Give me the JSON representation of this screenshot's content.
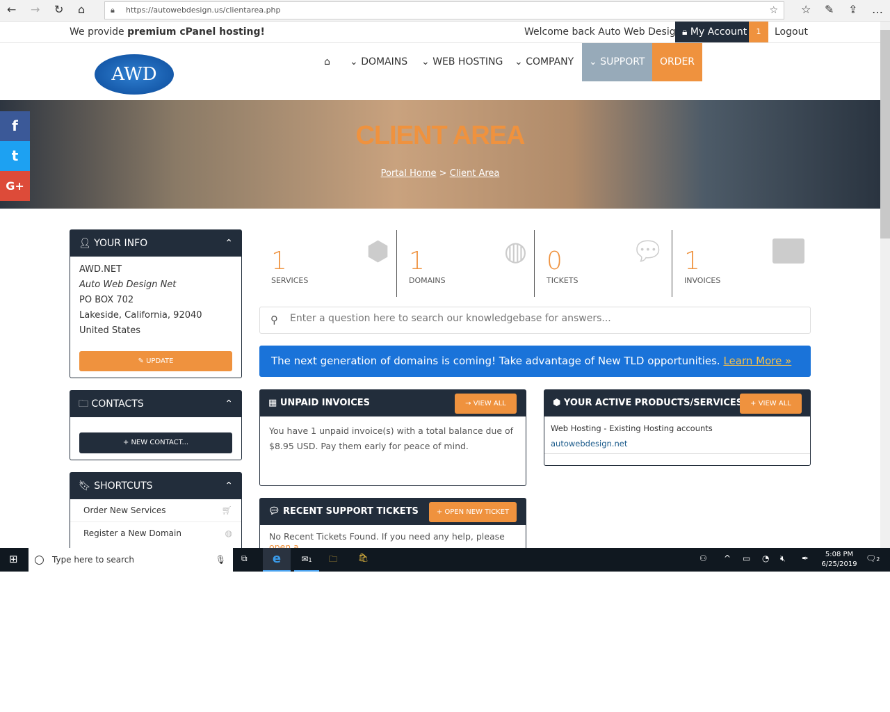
{
  "browser": {
    "url": "https://autowebdesign.us/clientarea.php"
  },
  "topbar": {
    "tagline_pre": "We provide ",
    "tagline_bold": "premium cPanel hosting!",
    "welcome": "Welcome back Auto Web Design!",
    "my_account": "My Account",
    "badge": "1",
    "logout": "Logout"
  },
  "header": {
    "logo": "AWD",
    "nav": [
      "DOMAINS",
      "WEB HOSTING",
      "COMPANY",
      "SUPPORT",
      "ORDER"
    ]
  },
  "hero": {
    "title": "CLIENT AREA",
    "breadcrumb": [
      "Portal Home",
      "Client Area"
    ],
    "separator": ">"
  },
  "sidebar": {
    "your_info": {
      "title": "YOUR INFO",
      "company": "AWD.NET",
      "name": "Auto Web Design Net",
      "address": "PO BOX 702",
      "city": "Lakeside, California, 92040",
      "country": "United States",
      "update": "UPDATE"
    },
    "contacts": {
      "title": "CONTACTS",
      "new_contact": "+ NEW CONTACT..."
    },
    "shortcuts": {
      "title": "SHORTCUTS",
      "items": [
        "Order New Services",
        "Register a New Domain"
      ]
    }
  },
  "stats": [
    {
      "value": "1",
      "label": "SERVICES",
      "icon": "cube-icon"
    },
    {
      "value": "1",
      "label": "DOMAINS",
      "icon": "globe-icon"
    },
    {
      "value": "0",
      "label": "TICKETS",
      "icon": "comments-icon"
    },
    {
      "value": "1",
      "label": "INVOICES",
      "icon": "credit-card-icon"
    }
  ],
  "search": {
    "placeholder": "Enter a question here to search our knowledgebase for answers..."
  },
  "banner": {
    "text": "The next generation of domains is coming! Take advantage of New TLD opportunities. ",
    "link": "Learn More »"
  },
  "unpaid": {
    "title": "UNPAID INVOICES",
    "button": "→ VIEW ALL",
    "body": "You have 1 unpaid invoice(s) with a total balance due of $8.95 USD. Pay them early for peace of mind."
  },
  "products": {
    "title": "YOUR ACTIVE PRODUCTS/SERVICES",
    "button": "+ VIEW ALL",
    "item": "Web Hosting - Existing Hosting accounts",
    "domain": "autowebdesign.net"
  },
  "tickets": {
    "title": "RECENT SUPPORT TICKETS",
    "button": "+ OPEN NEW TICKET",
    "body": "No Recent Tickets Found. If you need any help, please ",
    "link": "open a"
  },
  "taskbar": {
    "search": "Type here to search",
    "time": "5:08 PM",
    "date": "6/25/2019",
    "mail_badge": "1",
    "notif_badge": "2"
  },
  "colors": {
    "accent": "#ef923e",
    "dark": "#222d3b",
    "banner": "#1a73d9",
    "support": "#97aab9"
  }
}
